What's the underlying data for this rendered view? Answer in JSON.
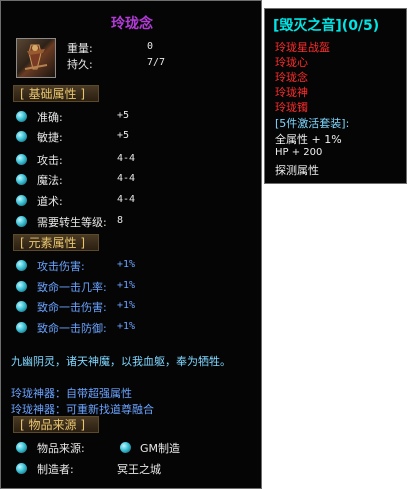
{
  "item": {
    "name": "玲珑念",
    "weight_label": "重量:",
    "weight": "0",
    "durability_label": "持久:",
    "durability": "7/7"
  },
  "sections": {
    "basic": "基础属性",
    "element": "元素属性",
    "source": "物品来源"
  },
  "basic_attrs": [
    {
      "label": "准确:",
      "value": "+5"
    },
    {
      "label": "敏捷:",
      "value": "+5"
    },
    {
      "label": "攻击:",
      "value": "4-4"
    },
    {
      "label": "魔法:",
      "value": "4-4"
    },
    {
      "label": "道术:",
      "value": "4-4"
    },
    {
      "label": "需要转生等级:",
      "value": "8"
    }
  ],
  "element_attrs": [
    {
      "label": "攻击伤害:",
      "value": "+1%"
    },
    {
      "label": "致命一击几率:",
      "value": "+1%"
    },
    {
      "label": "致命一击伤害:",
      "value": "+1%"
    },
    {
      "label": "致命一击防御:",
      "value": "+1%"
    }
  ],
  "flavor_text": "九幽阴灵，诸天神魔，以我血躯，奉为牺牲。",
  "artifact_lines": [
    "玲珑神器：自带超强属性",
    "玲珑神器：可重新找道尊融合"
  ],
  "source_rows": {
    "origin_label": "物品来源:",
    "origin_value": "GM制造",
    "maker_label": "制造者:",
    "maker_value": "冥王之城"
  },
  "set_panel": {
    "title": "[毁灭之音](0/5)",
    "pieces": [
      "玲珑星战盔",
      "玲珑心",
      "玲珑念",
      "玲珑神",
      "玲珑镯"
    ],
    "bonus_header": "[5件激活套装]:",
    "bonuses": [
      "全属性 + 1%",
      "HP + 200",
      "探测属性"
    ]
  },
  "colors": {
    "name": "#b33bd8",
    "section_text": "#e9c66e",
    "element_text": "#6aa3ff",
    "set_title": "#00e5e5",
    "set_piece_inactive": "#ff2b2b"
  }
}
